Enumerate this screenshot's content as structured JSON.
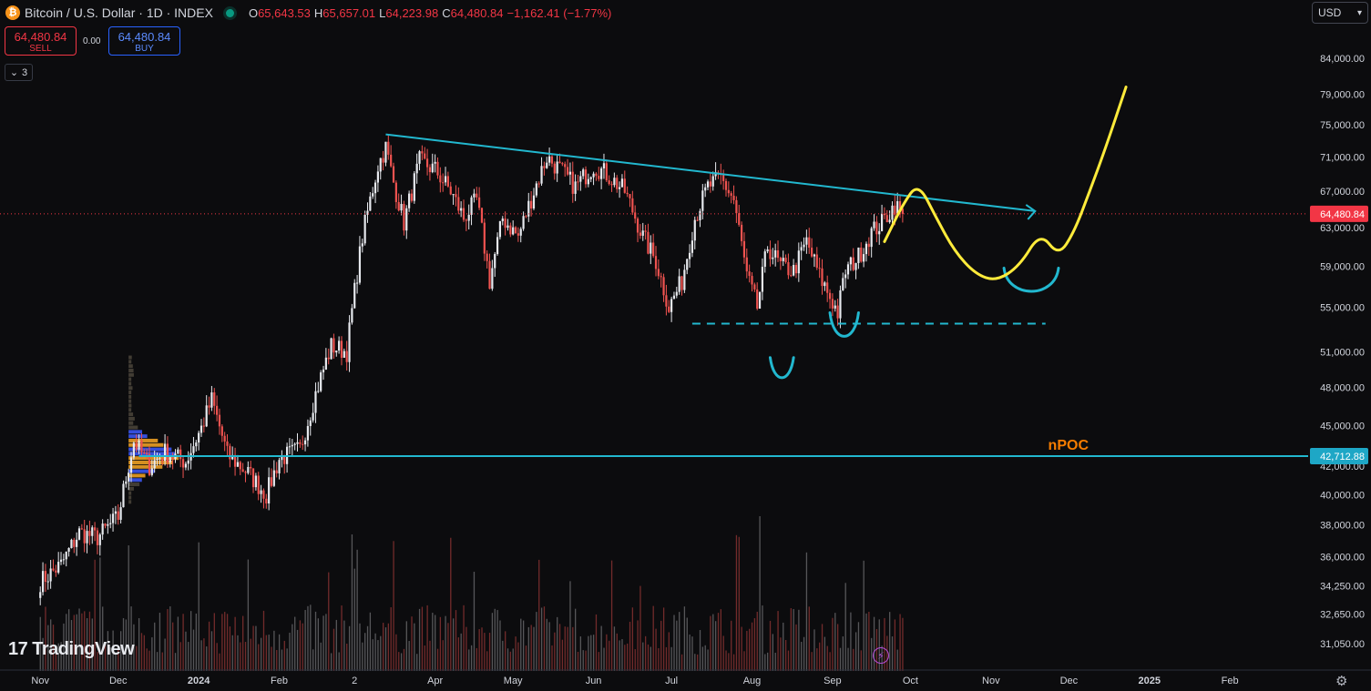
{
  "header": {
    "symbol": "Bitcoin / U.S. Dollar · 1D · INDEX",
    "logo_glyph": "₿",
    "open_label": "O",
    "open_value": "65,643.53",
    "high_label": "H",
    "high_value": "65,657.01",
    "low_label": "L",
    "low_value": "64,223.98",
    "close_label": "C",
    "close_value": "64,480.84",
    "change": "−1,162.41 (−1.77%)"
  },
  "trade": {
    "sell_price": "64,480.84",
    "sell_label": "SELL",
    "spread": "0.00",
    "buy_price": "64,480.84",
    "buy_label": "BUY"
  },
  "indicators_count": "3",
  "currency": "USD",
  "brand": "TradingView",
  "colors": {
    "up": "#e7e9ee",
    "down": "#ef5350",
    "trend": "#22b8cf",
    "projection": "#ffeb3b",
    "npoc_label": "#f57c00",
    "price_tag": "#f23645"
  },
  "chart_data": {
    "type": "candlestick",
    "y_scale": "log",
    "x_ticks": [
      {
        "t": 0,
        "label": "Nov"
      },
      {
        "t": 30,
        "label": "Dec"
      },
      {
        "t": 61,
        "label": "2024"
      },
      {
        "t": 92,
        "label": "Feb"
      },
      {
        "t": 121,
        "label": "2"
      },
      {
        "t": 152,
        "label": "Apr"
      },
      {
        "t": 182,
        "label": "May"
      },
      {
        "t": 213,
        "label": "Jun"
      },
      {
        "t": 243,
        "label": "Jul"
      },
      {
        "t": 274,
        "label": "Aug"
      },
      {
        "t": 305,
        "label": "Sep"
      },
      {
        "t": 335,
        "label": "Oct"
      },
      {
        "t": 366,
        "label": "Nov"
      },
      {
        "t": 396,
        "label": "Dec"
      },
      {
        "t": 427,
        "label": "2025"
      },
      {
        "t": 458,
        "label": "Feb"
      }
    ],
    "y_ticks": [
      {
        "v": 84000,
        "label": "84,000.00"
      },
      {
        "v": 79000,
        "label": "79,000.00"
      },
      {
        "v": 75000,
        "label": "75,000.00"
      },
      {
        "v": 71000,
        "label": "71,000.00"
      },
      {
        "v": 67000,
        "label": "67,000.00"
      },
      {
        "v": 63000,
        "label": "63,000.00"
      },
      {
        "v": 59000,
        "label": "59,000.00"
      },
      {
        "v": 55000,
        "label": "55,000.00"
      },
      {
        "v": 51000,
        "label": "51,000.00"
      },
      {
        "v": 48000,
        "label": "48,000.00"
      },
      {
        "v": 45000,
        "label": "45,000.00"
      },
      {
        "v": 42000,
        "label": "42,000.00"
      },
      {
        "v": 40000,
        "label": "40,000.00"
      },
      {
        "v": 38000,
        "label": "38,000.00"
      },
      {
        "v": 36000,
        "label": "36,000.00"
      },
      {
        "v": 34250,
        "label": "34,250.00"
      },
      {
        "v": 32650,
        "label": "32,650.00"
      },
      {
        "v": 31050,
        "label": "31,050.00"
      }
    ],
    "close_anchors": [
      [
        0,
        34500
      ],
      [
        8,
        35500
      ],
      [
        15,
        37500
      ],
      [
        22,
        37200
      ],
      [
        30,
        38500
      ],
      [
        36,
        43800
      ],
      [
        42,
        42000
      ],
      [
        48,
        43000
      ],
      [
        56,
        42300
      ],
      [
        62,
        44800
      ],
      [
        66,
        47000
      ],
      [
        72,
        42800
      ],
      [
        80,
        41500
      ],
      [
        87,
        40000
      ],
      [
        92,
        42500
      ],
      [
        100,
        43200
      ],
      [
        106,
        47500
      ],
      [
        112,
        51500
      ],
      [
        118,
        51000
      ],
      [
        124,
        62000
      ],
      [
        130,
        70000
      ],
      [
        133,
        72200
      ],
      [
        136,
        68000
      ],
      [
        140,
        63500
      ],
      [
        146,
        70500
      ],
      [
        152,
        69500
      ],
      [
        158,
        67000
      ],
      [
        163,
        64000
      ],
      [
        168,
        66000
      ],
      [
        173,
        57500
      ],
      [
        178,
        64000
      ],
      [
        184,
        62000
      ],
      [
        190,
        67000
      ],
      [
        195,
        71000
      ],
      [
        200,
        69500
      ],
      [
        206,
        67500
      ],
      [
        213,
        70000
      ],
      [
        218,
        69000
      ],
      [
        225,
        67000
      ],
      [
        232,
        62000
      ],
      [
        237,
        59500
      ],
      [
        242,
        55000
      ],
      [
        247,
        57500
      ],
      [
        252,
        64000
      ],
      [
        257,
        67500
      ],
      [
        262,
        68500
      ],
      [
        267,
        66000
      ],
      [
        272,
        58000
      ],
      [
        276,
        55000
      ],
      [
        280,
        61000
      ],
      [
        285,
        59000
      ],
      [
        290,
        58500
      ],
      [
        295,
        61500
      ],
      [
        300,
        58000
      ],
      [
        304,
        56000
      ],
      [
        307,
        54500
      ],
      [
        310,
        58500
      ],
      [
        315,
        60000
      ],
      [
        320,
        62500
      ],
      [
        324,
        63500
      ],
      [
        329,
        65500
      ],
      [
        332,
        64500
      ]
    ],
    "last_price": {
      "v": 64480.84,
      "label": "64,480.84"
    },
    "npoc": {
      "v": 42712.88,
      "label": "42,712.88",
      "text": "nPOC"
    },
    "trendline": [
      [
        133,
        73800
      ],
      [
        332,
        66400
      ],
      [
        383,
        66400
      ]
    ],
    "support": {
      "v": 53500,
      "t_start": 251,
      "t_end": 387
    },
    "projection": [
      [
        325,
        61500
      ],
      [
        332,
        65500
      ],
      [
        338,
        68000
      ],
      [
        345,
        64000
      ],
      [
        352,
        60500
      ],
      [
        360,
        58200
      ],
      [
        368,
        57500
      ],
      [
        377,
        59000
      ],
      [
        385,
        62500
      ],
      [
        392,
        60000
      ],
      [
        398,
        62500
      ],
      [
        404,
        67000
      ],
      [
        410,
        72000
      ],
      [
        418,
        80000
      ]
    ],
    "arcs": [
      {
        "t0": 281,
        "t1": 290,
        "vtop": 50500,
        "vbot": 49300
      },
      {
        "t0": 304,
        "t1": 315,
        "vtop": 54500,
        "vbot": 52800
      },
      {
        "t0": 371,
        "t1": 392,
        "vtop": 58800,
        "vbot": 57000
      }
    ]
  }
}
